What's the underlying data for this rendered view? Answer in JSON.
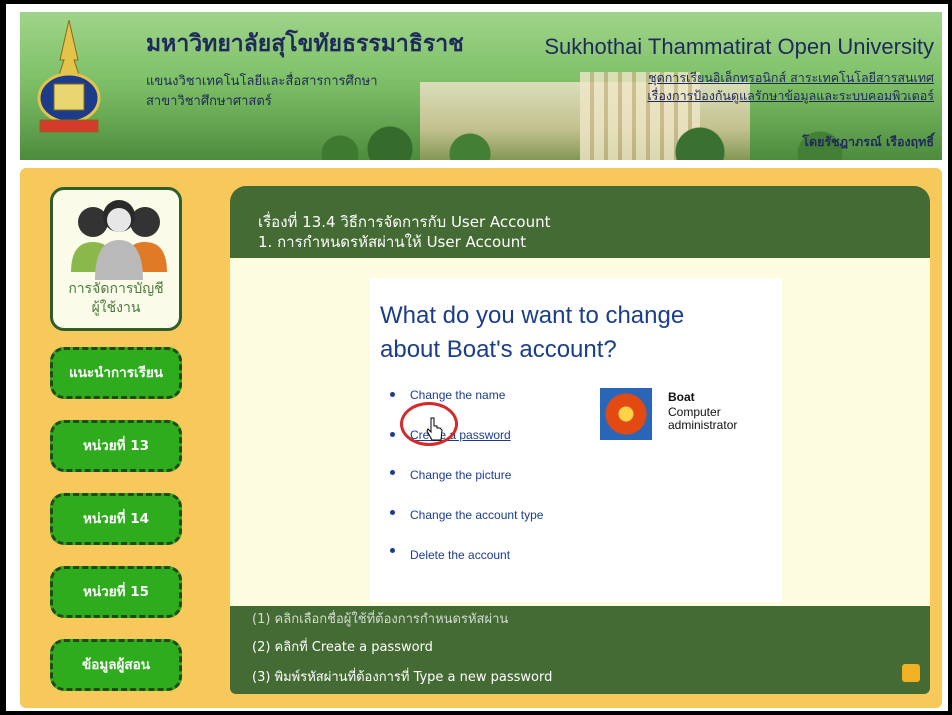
{
  "header": {
    "th_title": "มหาวิทยาลัยสุโขทัยธรรมาธิราช",
    "th_sub1": "แขนงวิชาเทคโนโลยีและสื่อสารการศึกษา",
    "th_sub2": "สาขาวิชาศึกษาศาสตร์",
    "en_title": "Sukhothai Thammatirat Open University",
    "right1": "ชุดการเรียนอิเล็กทรอนิกส์ สาระเทคโนโลยีสารสนเทศ",
    "right2": "เรื่องการป้องกันดูแลรักษาข้อมูลและระบบคอมพิวเตอร์",
    "right3": "โดยรัชฎาภรณ์ เรืองฤทธิ์"
  },
  "sidebar": {
    "top_label_1": "การจัดการบัญชี",
    "top_label_2": "ผู้ใช้งาน",
    "items": [
      {
        "label": "แนะนำการเรียน"
      },
      {
        "label": "หน่วยที่ 13"
      },
      {
        "label": "หน่วยที่ 14"
      },
      {
        "label": "หน่วยที่ 15"
      },
      {
        "label": "ข้อมูลผู้สอน"
      }
    ]
  },
  "content": {
    "lesson_line1": "เรื่องที่ 13.4 วิธีการจัดการกับ User Account",
    "lesson_line2": "1. การกำหนดรหัสผ่านให้ User Account",
    "question_line1": "What do you want to change",
    "question_line2": "about Boat's account?",
    "links": [
      {
        "label": "Change the name"
      },
      {
        "label": "Create a password"
      },
      {
        "label": "Change the picture"
      },
      {
        "label": "Change the account type"
      },
      {
        "label": "Delete the account"
      }
    ],
    "user": {
      "name": "Boat",
      "role": "Computer administrator"
    },
    "steps": [
      "(1) คลิกเลือกชื่อผู้ใช้ที่ต้องการกำหนดรหัสผ่าน",
      "(2) คลิกที่ Create a password",
      "(3) พิมพ์รหัสผ่านที่ต้องการที่ Type a new password"
    ]
  }
}
